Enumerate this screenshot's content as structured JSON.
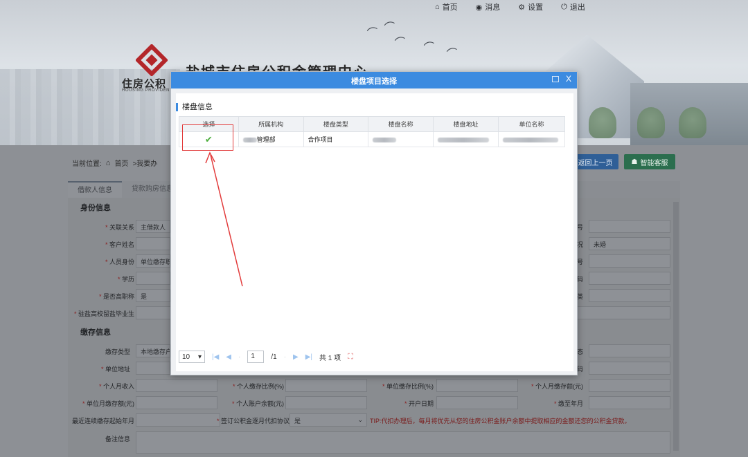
{
  "header": {
    "nav": [
      {
        "icon": "home-icon",
        "glyph": "⌂",
        "label": "首页"
      },
      {
        "icon": "message-icon",
        "glyph": "◉",
        "label": "消息"
      },
      {
        "icon": "gear-icon",
        "glyph": "⚙",
        "label": "设置"
      },
      {
        "icon": "power-icon",
        "glyph": "⏻",
        "label": "退出"
      }
    ],
    "logo_text": "住房公积",
    "logo_sub": "HOUSING PROVIDENT",
    "site_title": "盐城市住房公积金管理中心"
  },
  "breadcrumb": {
    "prefix": "当前位置:",
    "home": "首页",
    "path": ">我要办"
  },
  "actions": {
    "back": "返回上一页",
    "service": "智能客服"
  },
  "form": {
    "tabs": [
      "借款人信息",
      "贷款购房信息"
    ],
    "section1": "身份信息",
    "section2": "缴存信息",
    "rows1": [
      {
        "label": "关联关系",
        "required": true,
        "value": "主借款人",
        "right_label": "号",
        "right_value": ""
      },
      {
        "label": "客户姓名",
        "required": true,
        "value": "",
        "right_label": "况",
        "right_value": "未婚"
      },
      {
        "label": "人员身份",
        "required": true,
        "value": "单位缴存职",
        "right_label": "号",
        "right_value": ""
      },
      {
        "label": "学历",
        "required": true,
        "value": "",
        "right_label": "码",
        "right_value": ""
      },
      {
        "label": "是否高职称",
        "required": true,
        "value": "是",
        "right_label": "类",
        "right_value": ""
      },
      {
        "label": "驻盐高校留盐毕业生",
        "required": true,
        "value": "",
        "right_label": "",
        "right_value": ""
      }
    ],
    "rows2": [
      {
        "label": "缴存类型",
        "required": false,
        "value": "本地缴存户",
        "right_label": "态",
        "right_value": ""
      },
      {
        "label": "单位地址",
        "required": true,
        "value": "",
        "right_label": "码",
        "right_value": ""
      }
    ],
    "grid_row1": [
      {
        "label": "个人月收入",
        "value": ""
      },
      {
        "label": "个人缴存比例(%)",
        "value": ""
      },
      {
        "label": "单位缴存比例(%)",
        "value": ""
      },
      {
        "label": "个人月缴存额(元)",
        "value": ""
      }
    ],
    "grid_row2": [
      {
        "label": "单位月缴存额(元)",
        "value": ""
      },
      {
        "label": "个人账户余额(元)",
        "value": ""
      },
      {
        "label": "开户日期",
        "value": ""
      },
      {
        "label": "缴至年月",
        "value": ""
      }
    ],
    "last_row": {
      "label1": "最近连续缴存起始年月",
      "label2": "签订公积金逐月代扣协议",
      "value2": "是",
      "tip": "TIP:代扣办理后，每月将优先从您的住房公积金账户余额中提取相应的金额还您的公积金贷款。"
    },
    "remarks_label": "备注信息"
  },
  "modal": {
    "title": "楼盘项目选择",
    "close": "X",
    "section": "楼盘信息",
    "columns": [
      "选择",
      "所属机构",
      "楼盘类型",
      "楼盘名称",
      "楼盘地址",
      "单位名称"
    ],
    "row": {
      "org_suffix": "管理部",
      "type": "合作项目"
    },
    "pager": {
      "page_size": "10",
      "page": "1",
      "total_pages": "/1",
      "total": "共 1 项"
    }
  }
}
